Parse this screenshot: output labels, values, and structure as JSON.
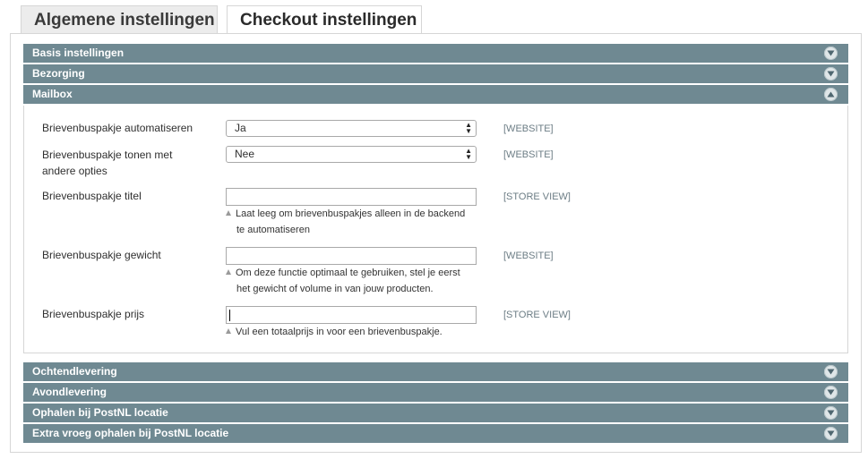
{
  "tabs": [
    {
      "label": "Algemene instellingen",
      "active": false
    },
    {
      "label": "Checkout instellingen",
      "active": true
    }
  ],
  "sections_top": [
    {
      "label": "Basis instellingen",
      "expanded": false
    },
    {
      "label": "Bezorging",
      "expanded": false
    },
    {
      "label": "Mailbox",
      "expanded": true
    }
  ],
  "mailbox": {
    "fields": [
      {
        "label": "Brievenbuspakje automatiseren",
        "type": "select",
        "value": "Ja",
        "scope": "[WEBSITE]"
      },
      {
        "label": "Brievenbuspakje tonen met andere opties",
        "type": "select",
        "value": "Nee",
        "scope": "[WEBSITE]"
      },
      {
        "label": "Brievenbuspakje titel",
        "type": "text",
        "value": "",
        "scope": "[STORE VIEW]",
        "note1": "Laat leeg om brievenbuspakjes alleen in de backend",
        "note2": "te automatiseren"
      },
      {
        "label": "Brievenbuspakje gewicht",
        "type": "text",
        "value": "",
        "scope": "[WEBSITE]",
        "note1": "Om deze functie optimaal te gebruiken, stel je eerst",
        "note2": "het gewicht of volume in van jouw producten."
      },
      {
        "label": "Brievenbuspakje prijs",
        "type": "text",
        "value": "",
        "scope": "[STORE VIEW]",
        "note1": "Vul een totaalprijs in voor een brievenbuspakje.",
        "focused": true
      }
    ]
  },
  "sections_bottom": [
    {
      "label": "Ochtendlevering",
      "expanded": false
    },
    {
      "label": "Avondlevering",
      "expanded": false
    },
    {
      "label": "Ophalen bij PostNL locatie",
      "expanded": false
    },
    {
      "label": "Extra vroeg ophalen bij PostNL locatie",
      "expanded": false
    }
  ],
  "colors": {
    "section_bar": "#6f8992",
    "scope_text": "#6c7d85"
  },
  "icons": {
    "collapsed": "chevron-down-icon",
    "expanded": "chevron-up-icon",
    "note": "triangle-up-icon"
  }
}
